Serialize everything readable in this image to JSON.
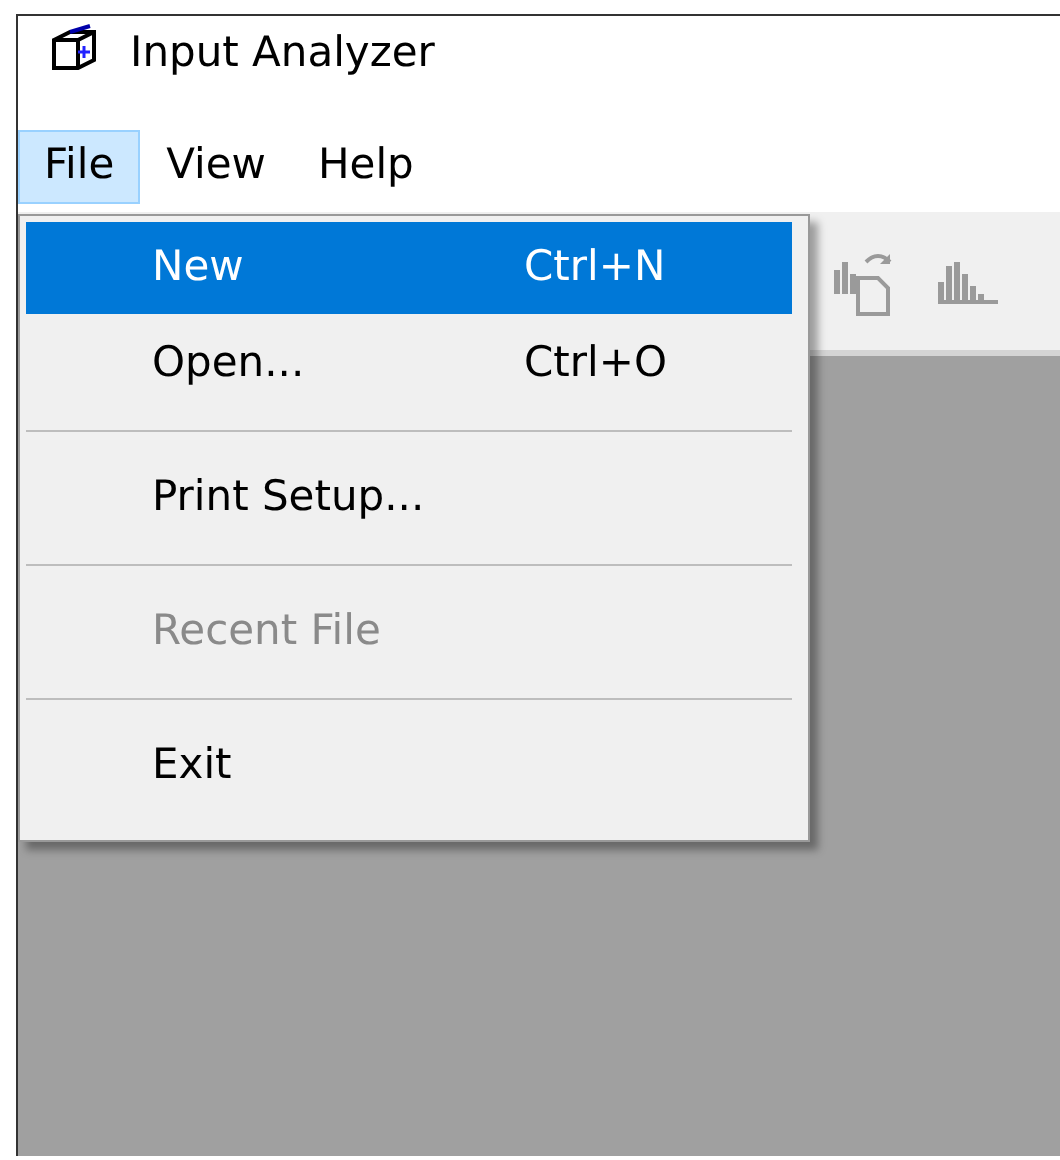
{
  "window": {
    "title": "Input Analyzer"
  },
  "menu_bar": [
    {
      "label": "File",
      "selected": true
    },
    {
      "label": "View",
      "selected": false
    },
    {
      "label": "Help",
      "selected": false
    }
  ],
  "file_menu": [
    {
      "kind": "item",
      "label": "New",
      "shortcut": "Ctrl+N",
      "selected": true,
      "disabled": false
    },
    {
      "kind": "item",
      "label": "Open...",
      "shortcut": "Ctrl+O",
      "selected": false,
      "disabled": false
    },
    {
      "kind": "separator"
    },
    {
      "kind": "item",
      "label": "Print Setup...",
      "selected": false,
      "disabled": false
    },
    {
      "kind": "separator"
    },
    {
      "kind": "item",
      "label": "Recent File",
      "selected": false,
      "disabled": true
    },
    {
      "kind": "separator"
    },
    {
      "kind": "item",
      "label": "Exit",
      "selected": false,
      "disabled": false
    }
  ],
  "toolbar": [
    {
      "kind": "chart-refresh",
      "disabled": true
    },
    {
      "kind": "histogram",
      "disabled": true
    }
  ]
}
